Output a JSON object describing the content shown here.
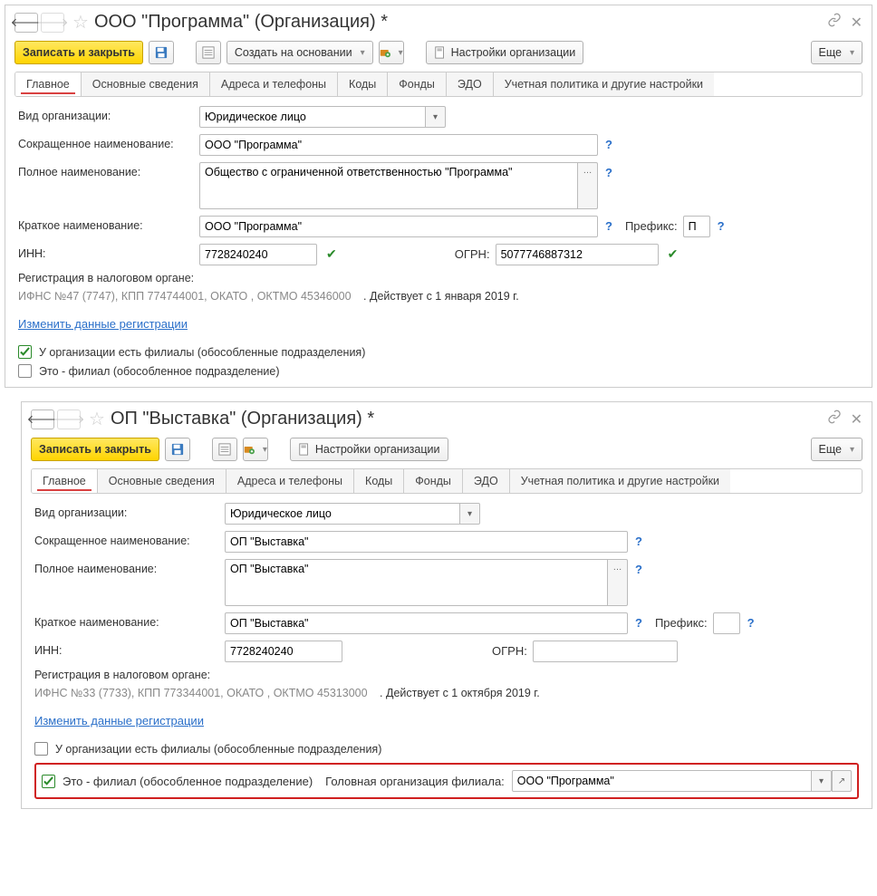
{
  "win1": {
    "title": "ООО \"Программа\" (Организация) *",
    "toolbar": {
      "save_close": "Записать и закрыть",
      "create_based": "Создать на основании",
      "settings": "Настройки организации",
      "more": "Еще"
    },
    "tabs": {
      "main": "Главное",
      "basic": "Основные сведения",
      "addr": "Адреса и телефоны",
      "codes": "Коды",
      "funds": "Фонды",
      "edo": "ЭДО",
      "policy": "Учетная политика и другие настройки"
    },
    "form": {
      "org_type_label": "Вид организации:",
      "org_type": "Юридическое лицо",
      "short_name_label": "Сокращенное наименование:",
      "short_name": "ООО \"Программа\"",
      "full_name_label": "Полное наименование:",
      "full_name": "Общество с ограниченной ответственностью \"Программа\"",
      "brief_name_label": "Краткое наименование:",
      "brief_name": "ООО \"Программа\"",
      "prefix_label": "Префикс:",
      "prefix": "П",
      "inn_label": "ИНН:",
      "inn": "7728240240",
      "ogrn_label": "ОГРН:",
      "ogrn": "5077746887312",
      "reg_header": "Регистрация в налоговом органе:",
      "reg_body": "ИФНС №47 (7747), КПП 774744001, ОКАТО , ОКТМО 45346000",
      "reg_date": ". Действует с 1 января 2019 г.",
      "change_link": "Изменить данные регистрации",
      "chk1": "У организации есть филиалы (обособленные подразделения)",
      "chk2": "Это - филиал (обособленное подразделение)"
    }
  },
  "win2": {
    "title": "ОП \"Выставка\" (Организация) *",
    "toolbar": {
      "save_close": "Записать и закрыть",
      "settings": "Настройки организации",
      "more": "Еще"
    },
    "tabs": {
      "main": "Главное",
      "basic": "Основные сведения",
      "addr": "Адреса и телефоны",
      "codes": "Коды",
      "funds": "Фонды",
      "edo": "ЭДО",
      "policy": "Учетная политика и другие настройки"
    },
    "form": {
      "org_type_label": "Вид организации:",
      "org_type": "Юридическое лицо",
      "short_name_label": "Сокращенное наименование:",
      "short_name": "ОП \"Выставка\"",
      "full_name_label": "Полное наименование:",
      "full_name": "ОП \"Выставка\"",
      "brief_name_label": "Краткое наименование:",
      "brief_name": "ОП \"Выставка\"",
      "prefix_label": "Префикс:",
      "prefix": "",
      "inn_label": "ИНН:",
      "inn": "7728240240",
      "ogrn_label": "ОГРН:",
      "ogrn": "",
      "reg_header": "Регистрация в налоговом органе:",
      "reg_body": "ИФНС №33 (7733), КПП 773344001, ОКАТО , ОКТМО 45313000",
      "reg_date": ". Действует с 1 октября 2019 г.",
      "change_link": "Изменить данные регистрации",
      "chk1": "У организации есть филиалы (обособленные подразделения)",
      "chk2": "Это - филиал (обособленное подразделение)",
      "parent_label": "Головная организация филиала:",
      "parent_value": "ООО \"Программа\""
    }
  }
}
